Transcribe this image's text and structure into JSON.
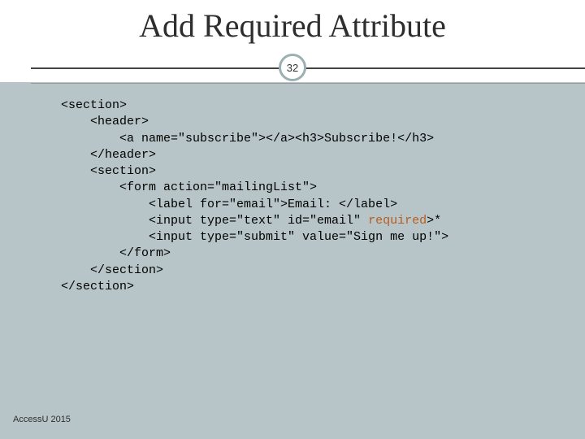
{
  "title": "Add Required Attribute",
  "slide_number": "32",
  "footer": "AccessU 2015",
  "code": {
    "l1": "<section>",
    "l2": "    <header>",
    "l3": "        <a name=\"subscribe\"></a><h3>Subscribe!</h3>",
    "l4": "    </header>",
    "l5": "    <section>",
    "l6": "        <form action=\"mailingList\">",
    "l7": "            <label for=\"email\">Email: </label>",
    "l8a": "            <input type=\"text\" id=\"email\" ",
    "l8h": "required",
    "l8b": ">*",
    "l9": "            <input type=\"submit\" value=\"Sign me up!\">",
    "l10": "        </form>",
    "l11": "    </section>",
    "l12": "</section>"
  }
}
